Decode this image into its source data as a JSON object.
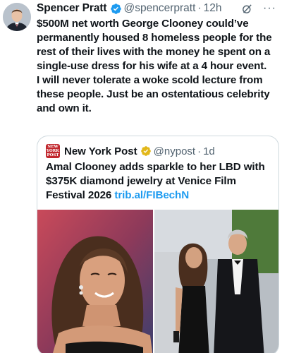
{
  "tweet": {
    "author": {
      "name": "Spencer Pratt",
      "handle": "@spencerpratt",
      "time": "12h",
      "dot": "·"
    },
    "lines": [
      "$500M net worth George Clooney could’ve permanently housed 8 homeless people for the rest of their lives with the money he spent on a single-use dress for his wife at a 4 hour event.",
      "I will never tolerate a woke scold lecture from these people. Just be an ostentatious celebrity and own it."
    ]
  },
  "quote": {
    "author": {
      "name": "New York Post",
      "handle": "@nypost",
      "time": "1d",
      "dot": "·",
      "logo_text_1": "NEW",
      "logo_text_2": "YORK",
      "logo_text_3": "POST"
    },
    "text": "Amal Clooney adds sparkle to her LBD with $375K diamond jewelry at Venice Film Festival 2026",
    "link": "trib.al/FIBechN"
  },
  "icons": {
    "verified": "verified-badge-icon",
    "grok": "grok-icon",
    "more": "more-icon"
  },
  "colors": {
    "verified_blue": "#1d9bf0",
    "verified_gold": "#e2b719",
    "link": "#1d9bf0",
    "nypost_red": "#c1272d",
    "muted": "#536471"
  }
}
